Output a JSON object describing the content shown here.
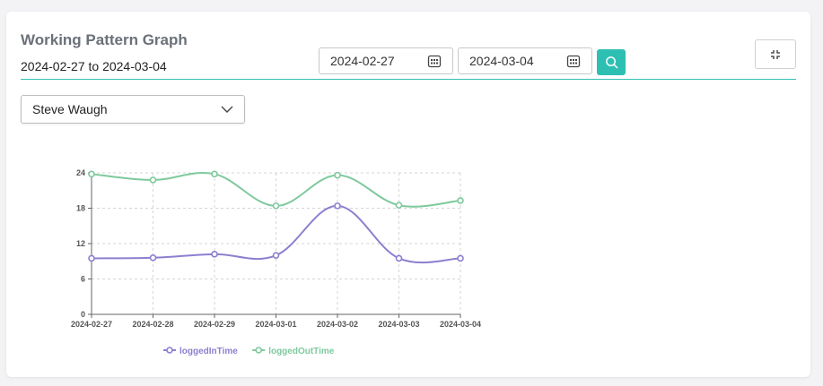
{
  "header": {
    "title": "Working Pattern Graph",
    "range_text": "2024-02-27 to 2024-03-04"
  },
  "filters": {
    "start_date": "2024-02-27",
    "end_date": "2024-03-04",
    "employee": "Steve Waugh"
  },
  "icons": {
    "calendar": "calendar-icon",
    "search": "search-icon",
    "expand": "expand-icon",
    "dropdown": "chevron-down-icon"
  },
  "colors": {
    "accent": "#2ebfb3",
    "logged_in": "#8b80cf",
    "logged_out": "#7ec99d"
  },
  "chart_data": {
    "type": "line",
    "categories": [
      "2024-02-27",
      "2024-02-28",
      "2024-02-29",
      "2024-03-01",
      "2024-03-02",
      "2024-03-03",
      "2024-03-04"
    ],
    "series": [
      {
        "name": "loggedInTime",
        "color": "#8b80cf",
        "values": [
          9.5,
          9.6,
          10.2,
          10.0,
          18.4,
          9.5,
          9.5
        ]
      },
      {
        "name": "loggedOutTime",
        "color": "#7ec99d",
        "values": [
          23.8,
          22.8,
          23.8,
          18.4,
          23.6,
          18.5,
          19.3
        ]
      }
    ],
    "yticks": [
      0,
      6,
      12,
      18,
      24
    ],
    "ylim": [
      0,
      24
    ],
    "grid": true,
    "legend": "bottom"
  }
}
